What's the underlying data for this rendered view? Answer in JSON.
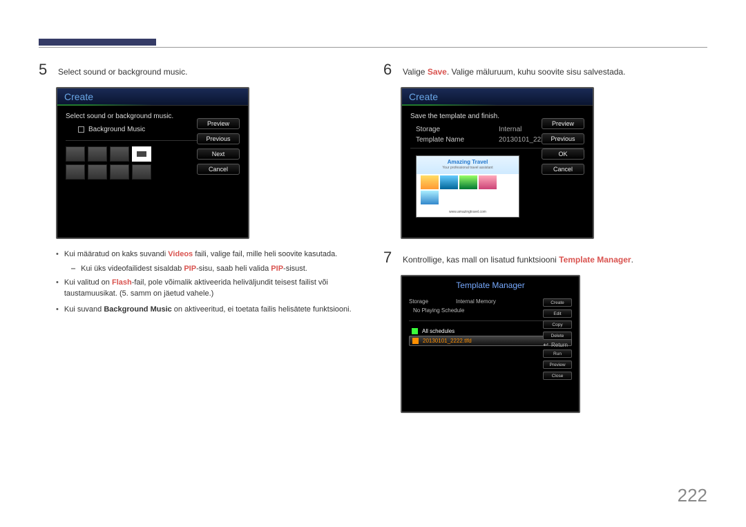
{
  "page_number": "222",
  "left": {
    "step5": {
      "num": "5",
      "text": "Select sound or background music."
    },
    "shot": {
      "title": "Create",
      "subtitle": "Select sound or background music.",
      "checkbox_label": "Background Music",
      "buttons": [
        "Preview",
        "Previous",
        "Next",
        "Cancel"
      ]
    },
    "bullets": {
      "b1_pre": "Kui määratud on kaks suvandi ",
      "b1_kw": "Videos",
      "b1_post": " faili, valige fail, mille heli soovite kasutada.",
      "b1sub_pre": "Kui üks videofailidest sisaldab ",
      "b1sub_kw1": "PIP",
      "b1sub_mid": "-sisu, saab heli valida ",
      "b1sub_kw2": "PIP",
      "b1sub_post": "-sisust.",
      "b2_pre": "Kui valitud on ",
      "b2_kw": "Flash",
      "b2_post": "-fail, pole võimalik aktiveerida heliväljundit teisest failist või taustamuusikat. (5. samm on jäetud vahele.)",
      "b3_pre": "Kui suvand ",
      "b3_kw": "Background Music",
      "b3_post": " on aktiveeritud, ei toetata failis helisätete funktsiooni."
    }
  },
  "right": {
    "step6": {
      "num": "6",
      "text_pre": "Valige ",
      "text_kw": "Save",
      "text_post": ". Valige mäluruum, kuhu soovite sisu salvestada."
    },
    "shot6": {
      "title": "Create",
      "subtitle": "Save the template and finish.",
      "storage_label": "Storage",
      "storage_value": "Internal",
      "tplname_label": "Template Name",
      "tplname_value": "20130101_2222",
      "preview_title": "Amazing Travel",
      "preview_sub": "Your professional travel assistant",
      "preview_url": "www.amazingtravel.com",
      "buttons": [
        "Preview",
        "Previous",
        "OK",
        "Cancel"
      ]
    },
    "step7": {
      "num": "7",
      "text_pre": "Kontrollige, kas mall on lisatud funktsiooni ",
      "text_kw": "Template Manager",
      "text_post": "."
    },
    "tm": {
      "title": "Template Manager",
      "storage_label": "Storage",
      "storage_value": "Internal Memory",
      "schedule_text": "No Playing Schedule",
      "allsched": "All schedules",
      "file": "20130101_2222.tlfd",
      "buttons": [
        "Create",
        "Edit",
        "Copy",
        "Delete",
        "Run",
        "Preview",
        "Close"
      ],
      "return": "Return"
    }
  }
}
